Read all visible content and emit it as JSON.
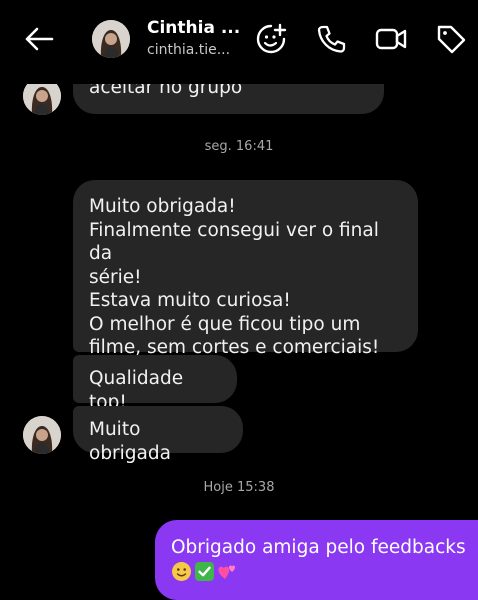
{
  "header": {
    "name": "Cinthia ...",
    "username": "cinthia.tie...",
    "icons": [
      "back-arrow-icon",
      "sticker-icon",
      "phone-icon",
      "video-icon",
      "tag-icon"
    ]
  },
  "messages": {
    "received_1": "aceitar no grupo",
    "timestamp_1": "seg. 16:41",
    "received_2_lines": [
      "Muito obrigada!",
      "Finalmente consegui ver o final da",
      "série!",
      "Estava muito curiosa!",
      "O melhor é que ficou tipo um",
      "filme, sem cortes e comerciais!"
    ],
    "received_3": "Qualidade top!",
    "received_4": "Muito obrigada",
    "timestamp_2": "Hoje 15:38",
    "sent_1": "Obrigado amiga pelo feedbacks",
    "sent_1_emojis": [
      "smiling-face-icon",
      "check-mark-icon",
      "two-hearts-icon"
    ]
  },
  "colors": {
    "background": "#000000",
    "received_bubble": "#262626",
    "sent_bubble": "#8b38f3",
    "timestamp": "#a8a8a8"
  }
}
